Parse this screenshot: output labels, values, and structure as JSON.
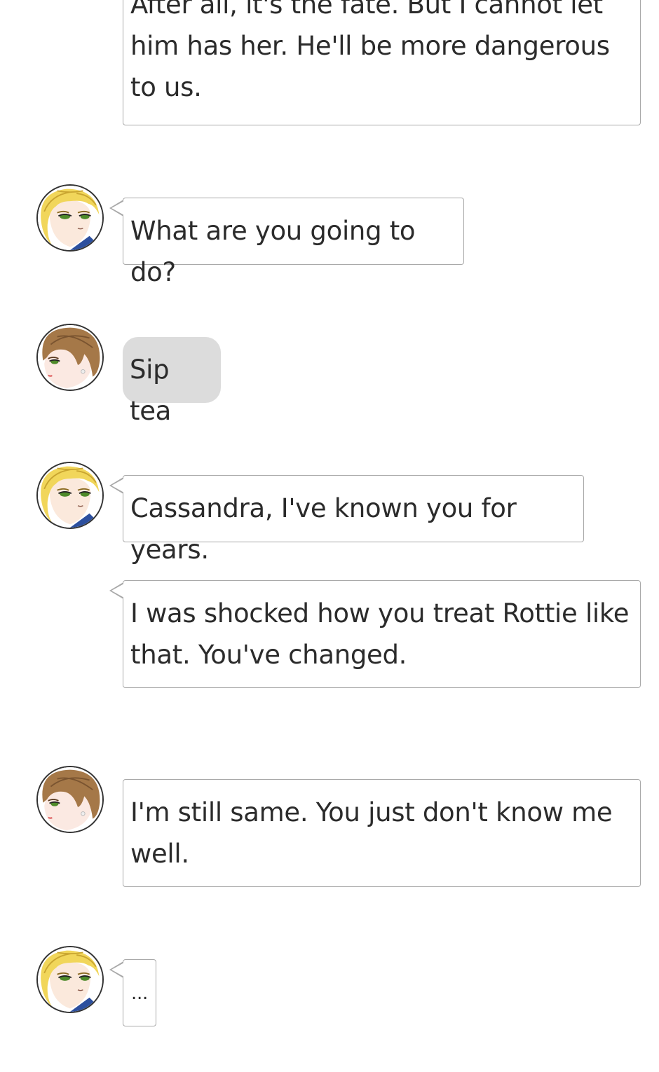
{
  "characters": {
    "blonde": {
      "name_icon": "blonde-character-avatar-icon",
      "hair": "#f1d65a",
      "hair_dark": "#c9a530",
      "skin": "#fbe9dc",
      "eye": "#4e8a2a",
      "outfit": "#2c4f9e"
    },
    "brunette": {
      "name_icon": "brunette-character-avatar-icon",
      "hair": "#a57848",
      "hair_dark": "#7a5430",
      "skin": "#fbe9e2",
      "eye": "#4e8a2a",
      "lip": "#e06a6a"
    }
  },
  "messages": [
    {
      "speaker": "blonde",
      "text": "After all, it's the fate. But I cannot let him has her. He'll be more dangerous to us."
    },
    {
      "speaker": "blonde",
      "text": "What are you going to do?"
    },
    {
      "speaker": "brunette",
      "kind": "action",
      "text": "Sip tea"
    },
    {
      "speaker": "blonde",
      "text": "Cassandra, I've known you for years."
    },
    {
      "speaker": "blonde",
      "text": "I was shocked how you treat Rottie like that. You've changed."
    },
    {
      "speaker": "brunette",
      "text": "I'm still same. You just don't know me well."
    },
    {
      "speaker": "blonde",
      "text": "..."
    }
  ]
}
